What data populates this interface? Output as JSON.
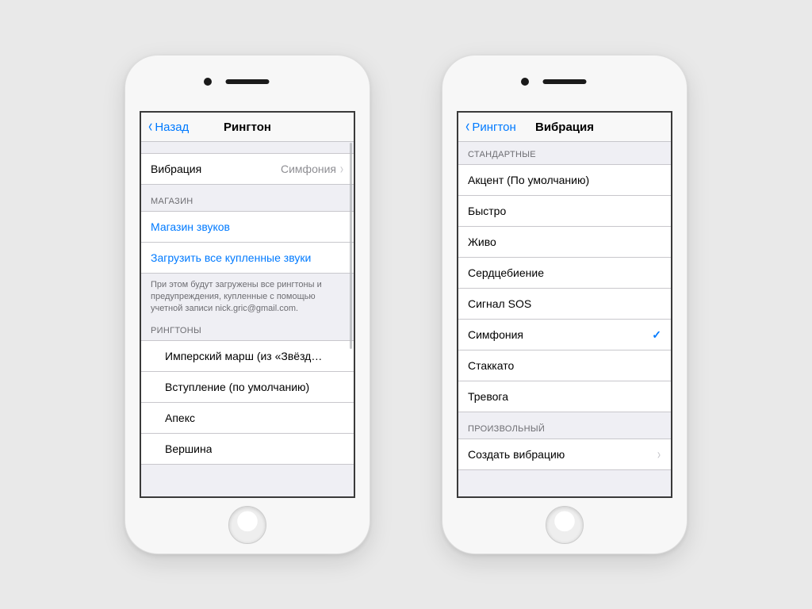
{
  "left": {
    "nav": {
      "back": "Назад",
      "title": "Рингтон"
    },
    "vibration_row": {
      "label": "Вибрация",
      "value": "Симфония"
    },
    "store_header": "МАГАЗИН",
    "store_links": [
      "Магазин звуков",
      "Загрузить все купленные звуки"
    ],
    "store_note": "При этом будут загружены все рингтоны и предупреждения, купленные с помощью учетной записи nick.gric@gmail.com.",
    "ringtones_header": "РИНГТОНЫ",
    "ringtones": [
      "Имперский марш (из «Звёзд…",
      "Вступление (по умолчанию)",
      "Апекс",
      "Вершина"
    ]
  },
  "right": {
    "nav": {
      "back": "Рингтон",
      "title": "Вибрация"
    },
    "standard_header": "СТАНДАРТНЫЕ",
    "standard": [
      {
        "label": "Акцент (По умолчанию)",
        "selected": false
      },
      {
        "label": "Быстро",
        "selected": false
      },
      {
        "label": "Живо",
        "selected": false
      },
      {
        "label": "Сердцебиение",
        "selected": false
      },
      {
        "label": "Сигнал SOS",
        "selected": false
      },
      {
        "label": "Симфония",
        "selected": true
      },
      {
        "label": "Стаккато",
        "selected": false
      },
      {
        "label": "Тревога",
        "selected": false
      }
    ],
    "custom_header": "ПРОИЗВОЛЬНЫЙ",
    "custom_row": "Создать вибрацию"
  }
}
